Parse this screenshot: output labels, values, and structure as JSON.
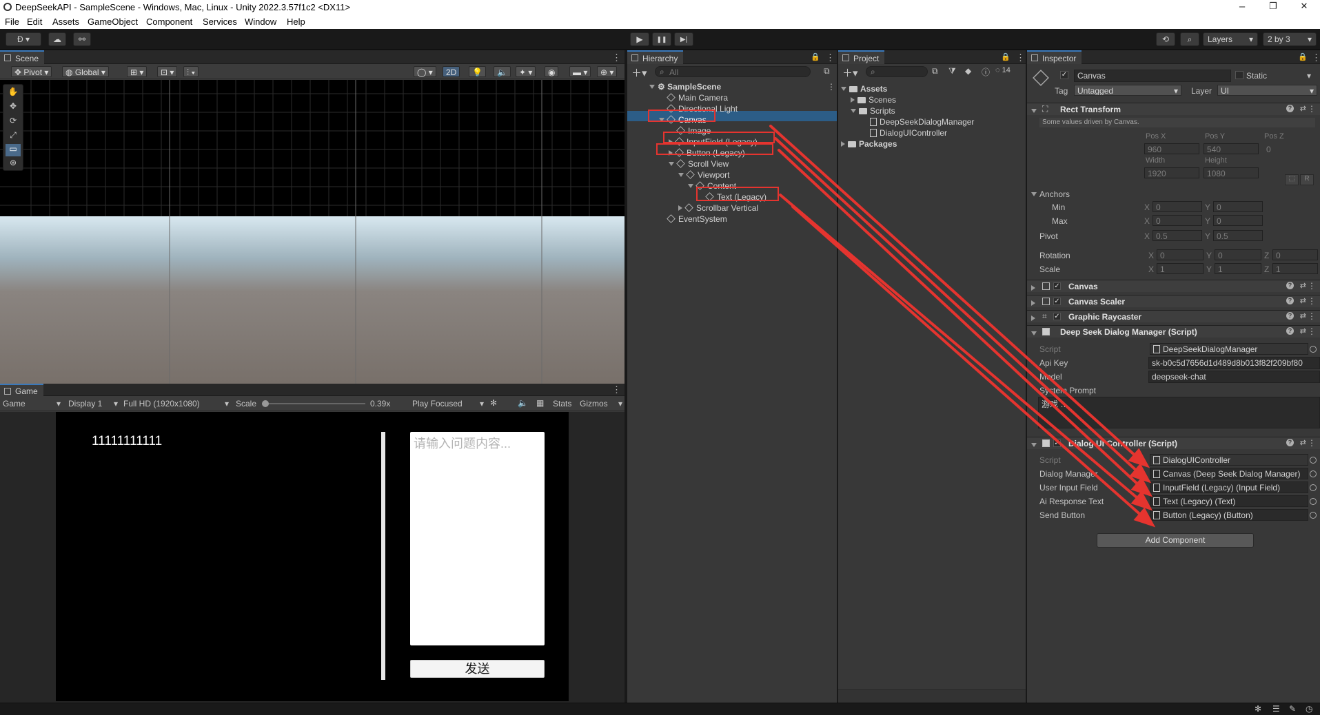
{
  "window": {
    "title": "DeepSeekAPI - SampleScene - Windows, Mac, Linux - Unity 2022.3.57f1c2 <DX11>",
    "minimize": "–",
    "maximize": "❐",
    "close": "✕"
  },
  "menu": [
    "File",
    "Edit",
    "Assets",
    "GameObject",
    "Component",
    "Services",
    "Window",
    "Help"
  ],
  "toolbar": {
    "account": "Ð",
    "layers": "Layers",
    "layout": "2 by 3",
    "play": "▶",
    "pause": "❚❚",
    "step": "▶|"
  },
  "scene": {
    "tab": "Scene",
    "pivot": "Pivot",
    "global": "Global",
    "mode2d": "2D"
  },
  "game": {
    "tab": "Game",
    "view": "Game",
    "display": "Display 1",
    "resolution": "Full HD (1920x1080)",
    "scale_label": "Scale",
    "scale_value": "0.39x",
    "play_focused": "Play Focused",
    "stats": "Stats",
    "gizmos": "Gizmos",
    "output_text": "11111111111",
    "input_placeholder": "请输入问题内容...",
    "send_label": "发送"
  },
  "hierarchy": {
    "tab": "Hierarchy",
    "search_placeholder": "All",
    "items": [
      "SampleScene",
      "Main Camera",
      "Directional Light",
      "Canvas",
      "Image",
      "InputField (Legacy)",
      "Button (Legacy)",
      "Scroll View",
      "Viewport",
      "Content",
      "Text (Legacy)",
      "Scrollbar Vertical",
      "EventSystem"
    ]
  },
  "project": {
    "tab": "Project",
    "count": "14",
    "items": [
      "Assets",
      "Scenes",
      "Scripts",
      "DeepSeekDialogManager",
      "DialogUIController",
      "Packages"
    ]
  },
  "inspector": {
    "tab": "Inspector",
    "object_name": "Canvas",
    "static_label": "Static",
    "tag_label": "Tag",
    "tag_value": "Untagged",
    "layer_label": "Layer",
    "layer_value": "UI",
    "rect": {
      "title": "Rect Transform",
      "note": "Some values driven by Canvas.",
      "posx_l": "Pos X",
      "posy_l": "Pos Y",
      "posz_l": "Pos Z",
      "posx": "960",
      "posy": "540",
      "posz": "0",
      "width_l": "Width",
      "height_l": "Height",
      "width": "1920",
      "height": "1080",
      "anchors": "Anchors",
      "min": "Min",
      "max": "Max",
      "min_x": "0",
      "min_y": "0",
      "max_x": "0",
      "max_y": "0",
      "pivot": "Pivot",
      "pivot_x": "0.5",
      "pivot_y": "0.5",
      "rotation": "Rotation",
      "rot_x": "0",
      "rot_y": "0",
      "rot_z": "0",
      "scale": "Scale",
      "scale_x": "1",
      "scale_y": "1",
      "scale_z": "1",
      "x": "X",
      "y": "Y",
      "z": "Z",
      "r": "R"
    },
    "components": [
      "Canvas",
      "Canvas Scaler",
      "Graphic Raycaster",
      "Deep Seek Dialog Manager (Script)"
    ],
    "dsm": {
      "script_l": "Script",
      "script_v": "DeepSeekDialogManager",
      "apikey_l": "Api Key",
      "apikey_v": "sk-b0c5d7656d1d489d8b013f82f209bf80",
      "model_l": "Model",
      "model_v": "deepseek-chat",
      "prompt_l": "System Prompt",
      "prompt_v": "游戏 …"
    },
    "ui": {
      "title": "Dialog UI Controller (Script)",
      "script_l": "Script",
      "script_v": "DialogUIController",
      "dm_l": "Dialog Manager",
      "dm_v": "Canvas (Deep Seek Dialog Manager)",
      "uif_l": "User Input Field",
      "uif_v": "InputField (Legacy) (Input Field)",
      "ai_l": "Ai Response Text",
      "ai_v": "Text (Legacy) (Text)",
      "sb_l": "Send Button",
      "sb_v": "Button (Legacy) (Button)"
    },
    "add_component": "Add Component"
  },
  "colors": {
    "selection": "#2c5d87",
    "annotation": "#e5342f",
    "panel": "#383838"
  }
}
